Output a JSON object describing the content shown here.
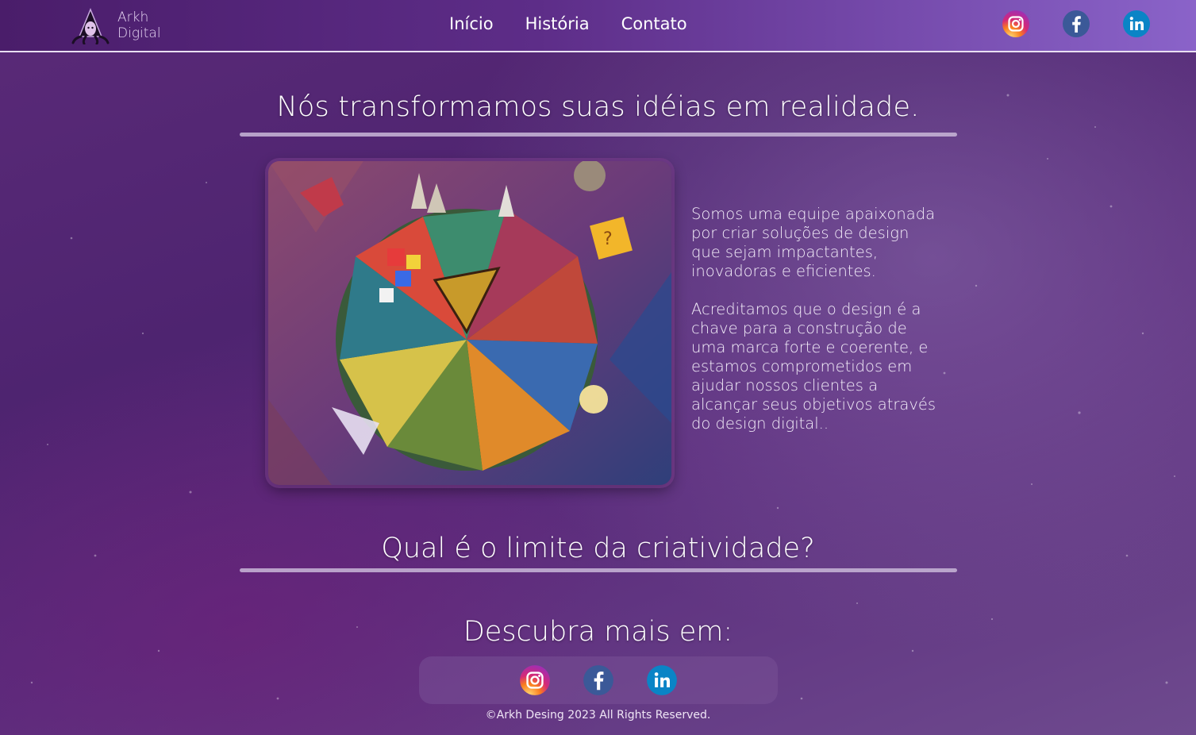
{
  "brand": {
    "line1": "Arkh",
    "line2": "Digital"
  },
  "nav": {
    "items": [
      {
        "label": "Início"
      },
      {
        "label": "História"
      },
      {
        "label": "Contato"
      }
    ]
  },
  "social": {
    "icons": [
      "instagram-icon",
      "facebook-icon",
      "linkedin-icon"
    ]
  },
  "hero": {
    "title": "Nós transformamos suas idéias em realidade.",
    "paragraph1": "Somos uma equipe apaixonada por criar soluções de design que sejam impactantes, inovadoras e eficientes.",
    "paragraph2": "Acreditamos que o design é a chave para a construção de uma marca forte e coerente, e estamos comprometidos em ajudar nossos clientes a alcançar seus objetivos através do design digital.."
  },
  "sections": {
    "question": "Qual é o limite da criatividade?",
    "discover": "Descubra mais em:"
  },
  "footer": {
    "copyright": "©Arkh Desing 2023 All Rights Reserved."
  },
  "colors": {
    "header_start": "#4a1d6a",
    "header_end": "#8a63c9",
    "background": "#552878",
    "divider": "#c9b7d8",
    "instagram": "#e1306c",
    "facebook": "#3b5998",
    "linkedin": "#0a84c6"
  }
}
